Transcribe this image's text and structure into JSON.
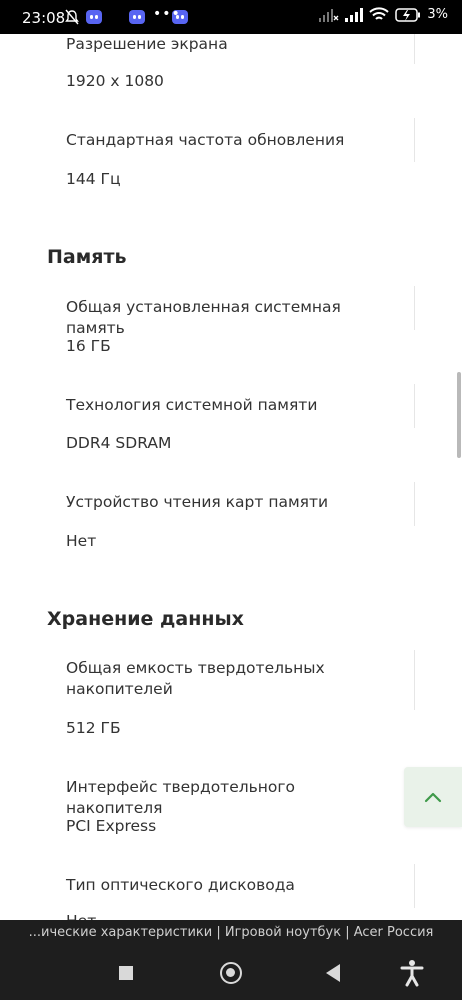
{
  "status_bar": {
    "time": "23:08",
    "battery": "3%",
    "more": "•••"
  },
  "sections": {
    "display": {
      "items": [
        {
          "label": "Разрешение экрана",
          "value": "1920 x 1080"
        },
        {
          "label": "Стандартная частота обновления",
          "value": "144 Гц"
        }
      ]
    },
    "memory": {
      "title": "Память",
      "items": [
        {
          "label": "Общая установленная системная память",
          "value": "16 ГБ"
        },
        {
          "label": "Технология системной памяти",
          "value": "DDR4 SDRAM"
        },
        {
          "label": "Устройство чтения карт памяти",
          "value": "Нет"
        }
      ]
    },
    "storage": {
      "title": "Хранение данных",
      "items": [
        {
          "label": "Общая емкость твердотельных накопителей",
          "value": "512 ГБ"
        },
        {
          "label": "Интерфейс твердотельного накопителя",
          "value": "PCI Express"
        },
        {
          "label": "Тип оптического дисковода",
          "value": "Нет"
        }
      ]
    }
  },
  "scroll_top_button": {
    "icon": "chevron-up-icon",
    "glyph": "⌃"
  },
  "browser": {
    "page_title": "...ические характеристики | Игровой ноутбук | Acer Россия"
  },
  "colors": {
    "accent": "#3f9a4a",
    "fab_bg": "#e9f2e9"
  }
}
